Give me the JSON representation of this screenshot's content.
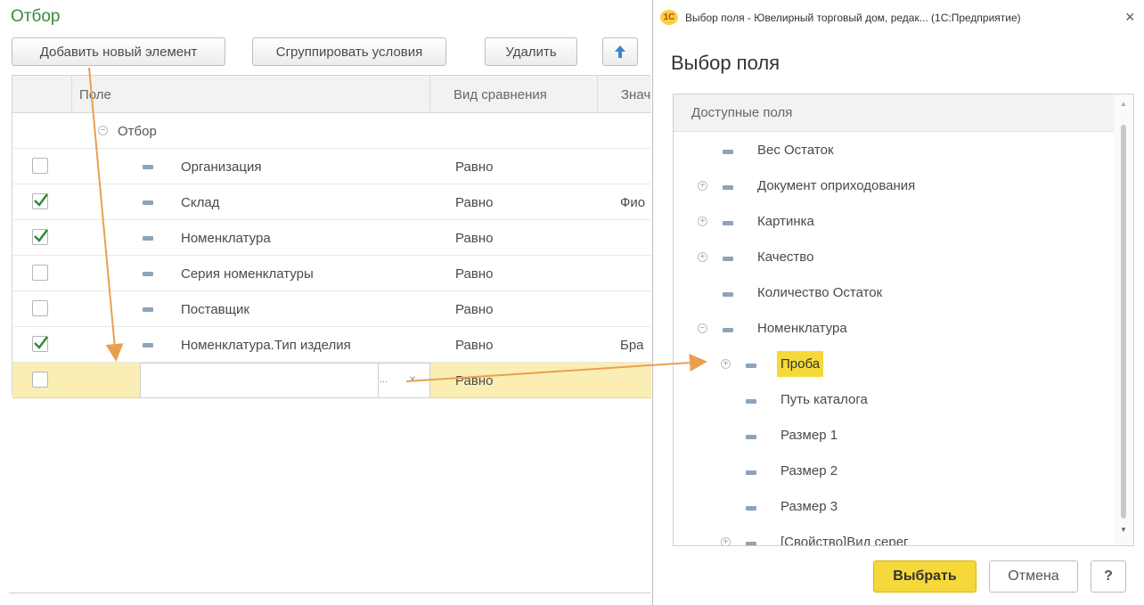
{
  "left_panel": {
    "title": "Отбор",
    "toolbar": {
      "add": "Добавить новый элемент",
      "group": "Сгруппировать условия",
      "delete": "Удалить"
    },
    "columns": [
      "Поле",
      "Вид сравнения",
      "Знач"
    ],
    "group_row": "Отбор",
    "rows": [
      {
        "checked": false,
        "field": "Организация",
        "comparison": "Равно",
        "value": ""
      },
      {
        "checked": true,
        "field": "Склад",
        "comparison": "Равно",
        "value": "Фио"
      },
      {
        "checked": true,
        "field": "Номенклатура",
        "comparison": "Равно",
        "value": ""
      },
      {
        "checked": false,
        "field": "Серия номенклатуры",
        "comparison": "Равно",
        "value": ""
      },
      {
        "checked": false,
        "field": "Поставщик",
        "comparison": "Равно",
        "value": ""
      },
      {
        "checked": true,
        "field": "Номенклатура.Тип изделия",
        "comparison": "Равно",
        "value": "Бра"
      }
    ],
    "new_row": {
      "checked": false,
      "field": "",
      "choose_button": "...",
      "clear_button": "×",
      "comparison": "Равно"
    }
  },
  "dialog": {
    "window_title": "Выбор поля - Ювелирный торговый дом, редак... (1С:Предприятие)",
    "logo_text": "1С",
    "close": "×",
    "heading": "Выбор поля",
    "tree_header": "Доступные поля",
    "items": [
      {
        "label": "Вес Остаток",
        "level": 0,
        "expander": "",
        "selected": false
      },
      {
        "label": "Документ оприходования",
        "level": 0,
        "expander": "plus",
        "selected": false
      },
      {
        "label": "Картинка",
        "level": 0,
        "expander": "plus",
        "selected": false
      },
      {
        "label": "Качество",
        "level": 0,
        "expander": "plus",
        "selected": false
      },
      {
        "label": "Количество Остаток",
        "level": 0,
        "expander": "",
        "selected": false
      },
      {
        "label": "Номенклатура",
        "level": 0,
        "expander": "minus",
        "selected": false
      },
      {
        "label": "Проба",
        "level": 1,
        "expander": "plus",
        "selected": true
      },
      {
        "label": "Путь каталога",
        "level": 1,
        "expander": "",
        "selected": false
      },
      {
        "label": "Размер 1",
        "level": 1,
        "expander": "",
        "selected": false
      },
      {
        "label": "Размер 2",
        "level": 1,
        "expander": "",
        "selected": false
      },
      {
        "label": "Размер 3",
        "level": 1,
        "expander": "",
        "selected": false
      },
      {
        "label": "[Свойство]Вид серег",
        "level": 1,
        "expander": "plus",
        "selected": false
      }
    ],
    "buttons": {
      "select": "Выбрать",
      "cancel": "Отмена",
      "help": "?"
    }
  },
  "colors": {
    "title_green": "#3a8a3a",
    "highlight_yellow": "#f5d83a",
    "row_highlight": "#fbeeb4",
    "annotation_arrow": "#e8a050",
    "check_green": "#2e8b3a"
  }
}
